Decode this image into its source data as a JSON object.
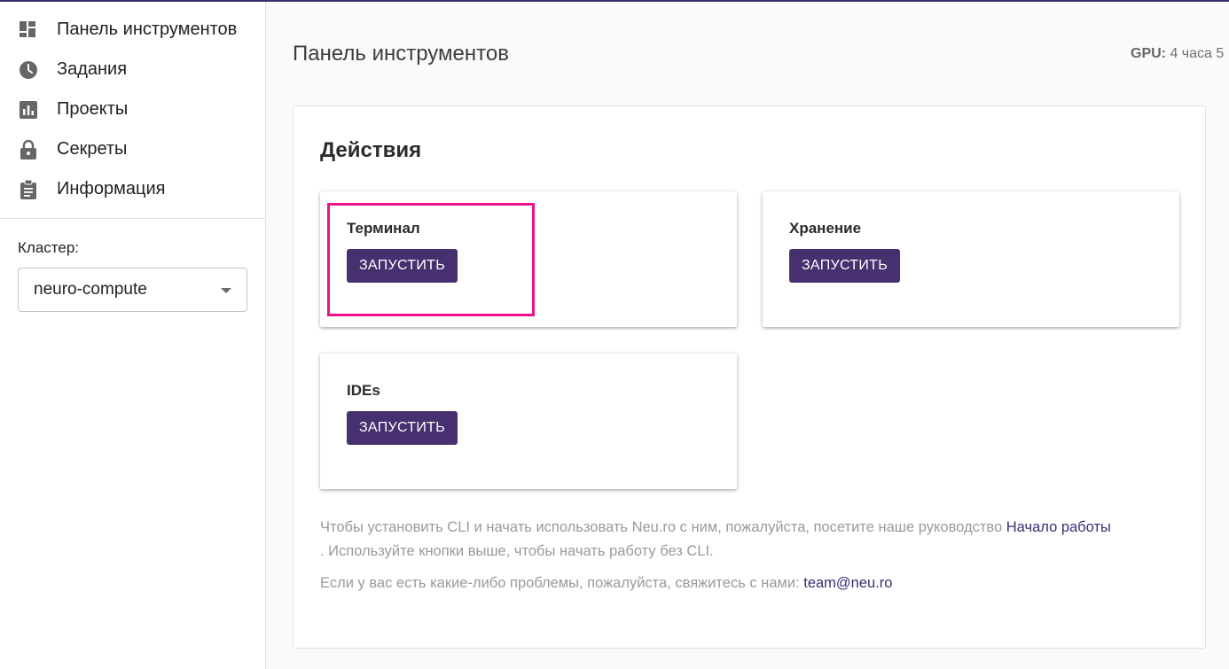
{
  "sidebar": {
    "items": [
      {
        "label": "Панель инструментов",
        "icon": "dashboard-icon"
      },
      {
        "label": "Задания",
        "icon": "clock-icon"
      },
      {
        "label": "Проекты",
        "icon": "bar-chart-icon"
      },
      {
        "label": "Секреты",
        "icon": "lock-icon"
      },
      {
        "label": "Информация",
        "icon": "clipboard-icon"
      }
    ],
    "cluster_label": "Кластер:",
    "cluster_value": "neuro-compute"
  },
  "header": {
    "title": "Панель инструментов",
    "gpu_label": "GPU:",
    "gpu_value": "4 часа 5"
  },
  "actions": {
    "title": "Действия",
    "cards": [
      {
        "title": "Терминал",
        "button": "ЗАПУСТИТЬ"
      },
      {
        "title": "Хранение",
        "button": "ЗАПУСТИТЬ"
      },
      {
        "title": "IDEs",
        "button": "ЗАПУСТИТЬ"
      }
    ]
  },
  "info": {
    "line1_text": "Чтобы установить CLI и начать использовать Neu.ro с ним, пожалуйста, посетите наше руководство",
    "line1_link": "Начало работы",
    "line1_tail": ". Используйте кнопки выше, чтобы начать работу без CLI.",
    "line2_text": "Если у вас есть какие-либо проблемы, пожалуйста, свяжитесь с нами:",
    "line2_link": "team@neu.ro"
  },
  "colors": {
    "accent": "#47306f",
    "highlight": "#f0108a",
    "link": "#3e2c72"
  }
}
